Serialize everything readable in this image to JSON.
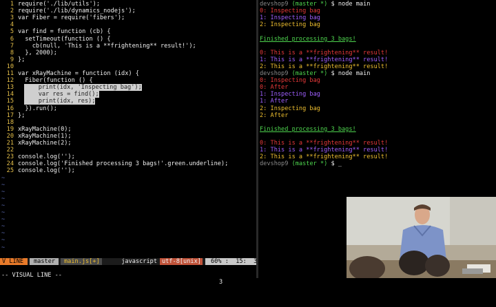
{
  "editor": {
    "lines": [
      {
        "n": "1",
        "t": "require('./lib/utils');"
      },
      {
        "n": "2",
        "t": "require('./lib/dynamics_nodejs');"
      },
      {
        "n": "3",
        "t": "var Fiber = require('fibers');"
      },
      {
        "n": "4",
        "t": ""
      },
      {
        "n": "5",
        "t": "var find = function (cb) {"
      },
      {
        "n": "6",
        "t": "  setTimeout(function () {"
      },
      {
        "n": "7",
        "t": "    cb(null, 'This is a **frightening** result!');"
      },
      {
        "n": "8",
        "t": "  }, 2000);"
      },
      {
        "n": "9",
        "t": "};"
      },
      {
        "n": "10",
        "t": ""
      },
      {
        "n": "11",
        "t": "var xRayMachine = function (idx) {"
      },
      {
        "n": "12",
        "t": "  Fiber(function () {"
      },
      {
        "n": "13",
        "t": "    print(idx, 'Inspecting bag');"
      },
      {
        "n": "14",
        "t": "    var res = find();"
      },
      {
        "n": "15",
        "t": "    print(idx, res);"
      },
      {
        "n": "16",
        "t": "  }).run();"
      },
      {
        "n": "17",
        "t": "};"
      },
      {
        "n": "18",
        "t": ""
      },
      {
        "n": "19",
        "t": "xRayMachine(0);"
      },
      {
        "n": "20",
        "t": "xRayMachine(1);"
      },
      {
        "n": "21",
        "t": "xRayMachine(2);"
      },
      {
        "n": "22",
        "t": ""
      },
      {
        "n": "23",
        "t": "console.log('');"
      },
      {
        "n": "24",
        "t": "console.log('Finished processing 3 bags!'.green.underline);"
      },
      {
        "n": "25",
        "t": "console.log('');"
      }
    ],
    "tilde": "~",
    "statusbar": {
      "mode": "V LINE",
      "branch": "master",
      "file": "main.js[+]",
      "filetype": "javascript",
      "encoding": "utf-8[unix]",
      "position": "60% :  15:  3"
    },
    "cmdline": {
      "mode": "-- VISUAL LINE --",
      "count": "3"
    }
  },
  "terminal": {
    "prompt": "devshop9",
    "branch": "(master *)",
    "cmd": "$ node main",
    "cursor_prompt": "$ _",
    "run1": [
      {
        "c": "c0",
        "t": "0: Inspecting bag"
      },
      {
        "c": "c1",
        "t": "1: Inspecting bag"
      },
      {
        "c": "c2",
        "t": "2: Inspecting bag"
      },
      {
        "c": "",
        "t": ""
      },
      {
        "c": "gr",
        "t": "Finished processing 3 bags!"
      },
      {
        "c": "",
        "t": ""
      },
      {
        "c": "c0",
        "t": "0: This is a **frightening** result!"
      },
      {
        "c": "c1",
        "t": "1: This is a **frightening** result!"
      },
      {
        "c": "c2",
        "t": "2: This is a **frightening** result!"
      }
    ],
    "run2": [
      {
        "c": "c0",
        "t": "0: Inspecting bag"
      },
      {
        "c": "c0",
        "t": "0: After"
      },
      {
        "c": "c1",
        "t": "1: Inspecting bag"
      },
      {
        "c": "c1",
        "t": "1: After"
      },
      {
        "c": "c2",
        "t": "2: Inspecting bag"
      },
      {
        "c": "c2",
        "t": "2: After"
      },
      {
        "c": "",
        "t": ""
      },
      {
        "c": "gr",
        "t": "Finished processing 3 bags!"
      },
      {
        "c": "",
        "t": ""
      },
      {
        "c": "c0",
        "t": "0: This is a **frightening** result!"
      },
      {
        "c": "c1",
        "t": "1: This is a **frightening** result!"
      },
      {
        "c": "c2",
        "t": "2: This is a **frightening** result!"
      }
    ]
  },
  "colors": {
    "line_number": "#e6c04a",
    "mode_bg": "#e87a2a",
    "branch_bg": "#b0b0b0",
    "file_bg": "#4a4a4a",
    "encoding_bg": "#c0533a",
    "position_bg": "#c8c8c8"
  }
}
